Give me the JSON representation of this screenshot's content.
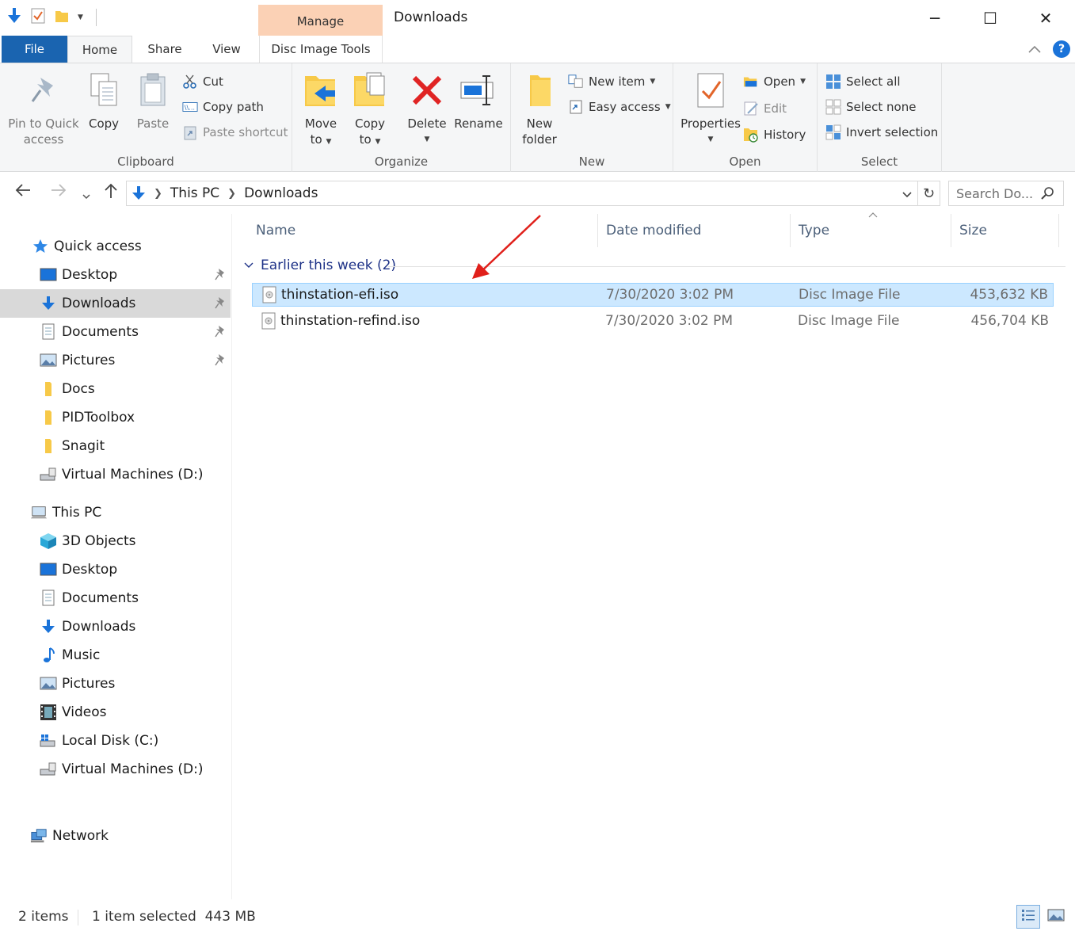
{
  "window": {
    "title": "Downloads",
    "contextual_tab_group": "Manage",
    "minimize": "─",
    "maximize": "☐",
    "close": "✕"
  },
  "tabs": {
    "file": "File",
    "home": "Home",
    "share": "Share",
    "view": "View",
    "disc_image_tools": "Disc Image Tools",
    "help": "?"
  },
  "ribbon": {
    "clipboard": {
      "label": "Clipboard",
      "pin_line1": "Pin to Quick",
      "pin_line2": "access",
      "copy": "Copy",
      "paste": "Paste",
      "cut": "Cut",
      "copy_path": "Copy path",
      "paste_shortcut": "Paste shortcut"
    },
    "organize": {
      "label": "Organize",
      "move_line1": "Move",
      "move_line2": "to",
      "copy_line1": "Copy",
      "copy_line2": "to",
      "delete": "Delete",
      "rename": "Rename"
    },
    "new": {
      "label": "New",
      "folder_line1": "New",
      "folder_line2": "folder",
      "new_item": "New item",
      "easy_access": "Easy access"
    },
    "open": {
      "label": "Open",
      "properties": "Properties",
      "open": "Open",
      "edit": "Edit",
      "history": "History"
    },
    "select": {
      "label": "Select",
      "select_all": "Select all",
      "select_none": "Select none",
      "invert_selection": "Invert selection"
    }
  },
  "address": {
    "crumbs": [
      "This PC",
      "Downloads"
    ],
    "search_placeholder": "Search Do..."
  },
  "nav": {
    "quick_access": "Quick access",
    "quick_items": [
      "Desktop",
      "Downloads",
      "Documents",
      "Pictures",
      "Docs",
      "PIDToolbox",
      "Snagit",
      "Virtual Machines (D:)"
    ],
    "this_pc": "This PC",
    "pc_items": [
      "3D Objects",
      "Desktop",
      "Documents",
      "Downloads",
      "Music",
      "Pictures",
      "Videos",
      "Local Disk (C:)",
      "Virtual Machines (D:)"
    ],
    "network": "Network"
  },
  "columns": {
    "name": "Name",
    "date_modified": "Date modified",
    "type": "Type",
    "size": "Size"
  },
  "group": {
    "label": "Earlier this week (2)"
  },
  "files": [
    {
      "name": "thinstation-efi.iso",
      "date": "7/30/2020 3:02 PM",
      "type": "Disc Image File",
      "size": "453,632 KB",
      "selected": true
    },
    {
      "name": "thinstation-refind.iso",
      "date": "7/30/2020 3:02 PM",
      "type": "Disc Image File",
      "size": "456,704 KB",
      "selected": false
    }
  ],
  "status": {
    "item_count": "2 items",
    "selection": "1 item selected  443 MB"
  },
  "colors": {
    "file_tab": "#1a64b0",
    "manage_tab": "#fbd1b5",
    "selection": "#cce8ff",
    "annotation_arrow": "#e0201b"
  }
}
